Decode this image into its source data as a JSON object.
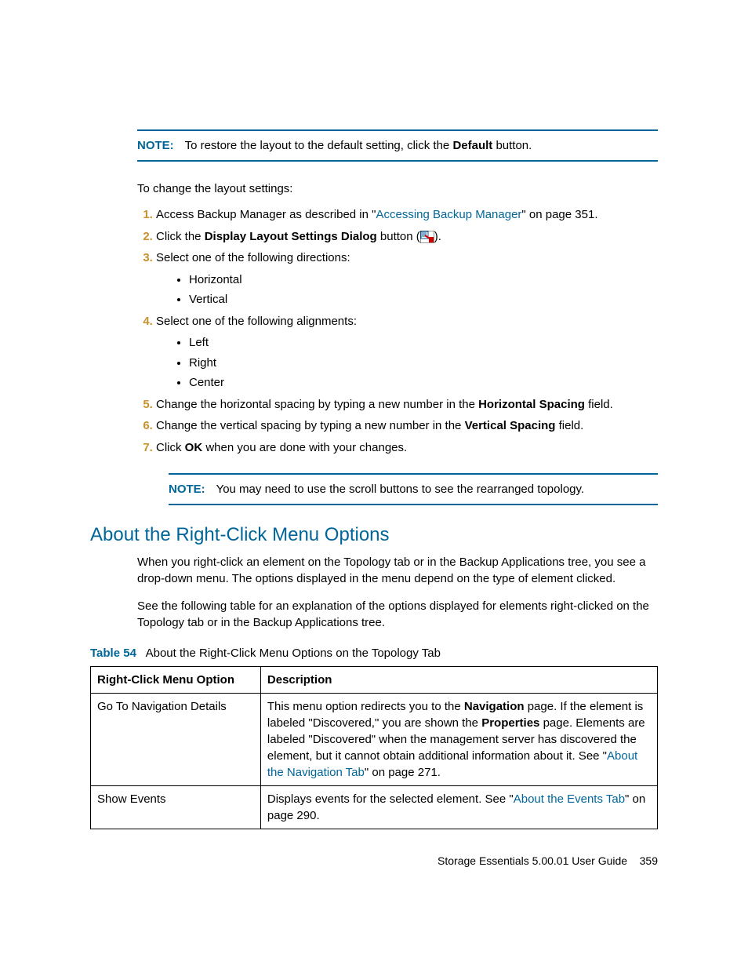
{
  "note1": {
    "label": "NOTE:",
    "t1": "To restore the layout to the default setting, click the ",
    "bold": "Default",
    "t2": " button."
  },
  "intro": "To change the layout settings:",
  "steps": {
    "s1": {
      "t1": "Access Backup Manager as described in \"",
      "link": "Accessing Backup Manager",
      "t2": "\" on page 351."
    },
    "s2": {
      "t1": "Click the ",
      "bold": "Display Layout Settings Dialog",
      "t2": " button (",
      "t3": ")."
    },
    "s3": {
      "t": "Select one of the following directions:",
      "b1": "Horizontal",
      "b2": "Vertical"
    },
    "s4": {
      "t": "Select one of the following alignments:",
      "b1": "Left",
      "b2": "Right",
      "b3": "Center"
    },
    "s5": {
      "t1": "Change the horizontal spacing by typing a new number in the ",
      "bold": "Horizontal Spacing",
      "t2": " field."
    },
    "s6": {
      "t1": "Change the vertical spacing by typing a new number in the ",
      "bold": "Vertical Spacing",
      "t2": " field."
    },
    "s7": {
      "t1": "Click ",
      "bold": "OK",
      "t2": " when you are done with your changes."
    }
  },
  "note2": {
    "label": "NOTE:",
    "text": "You may need to use the scroll buttons to see the rearranged topology."
  },
  "section_heading": "About the Right-Click Menu Options",
  "para1": "When you right-click an element on the Topology tab or in the Backup Applications tree, you see a drop-down menu. The options displayed in the menu depend on the type of element clicked.",
  "para2": "See the following table for an explanation of the options displayed for elements right-clicked on the Topology tab or in the Backup Applications tree.",
  "table": {
    "caption_label": "Table 54",
    "caption_text": "About the Right-Click Menu Options on the Topology Tab",
    "h1": "Right-Click Menu Option",
    "h2": "Description",
    "r1": {
      "opt": "Go To Navigation Details",
      "d1": "This menu option redirects you to the ",
      "b1": "Navigation",
      "d2": " page. If the element is labeled \"Discovered,\" you are shown the ",
      "b2": "Properties",
      "d3": " page. Elements are labeled \"Discovered\" when the management server has discovered the element, but it cannot obtain additional information about it. See \"",
      "link": "About the Navigation Tab",
      "d4": "\" on page 271."
    },
    "r2": {
      "opt": "Show Events",
      "d1": "Displays events for the selected element. See \"",
      "link": "About the Events Tab",
      "d2": "\" on page 290."
    }
  },
  "footer": {
    "text": "Storage Essentials 5.00.01 User Guide",
    "page": "359"
  }
}
